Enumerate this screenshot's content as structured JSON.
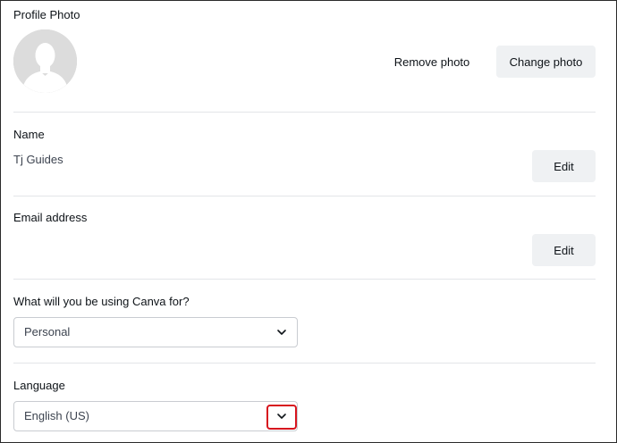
{
  "profile_photo": {
    "label": "Profile Photo",
    "remove_label": "Remove photo",
    "change_label": "Change photo"
  },
  "name": {
    "label": "Name",
    "value": "Tj Guides",
    "edit_label": "Edit"
  },
  "email": {
    "label": "Email address",
    "value": "",
    "edit_label": "Edit"
  },
  "usage": {
    "label": "What will you be using Canva for?",
    "selected": "Personal"
  },
  "language": {
    "label": "Language",
    "selected": "English (US)"
  },
  "icons": {
    "avatar": "user-silhouette-icon",
    "dropdown": "chevron-down-icon"
  },
  "colors": {
    "button_bg": "#eff1f3",
    "divider": "#e3e5e8",
    "highlight": "#d7141e"
  }
}
